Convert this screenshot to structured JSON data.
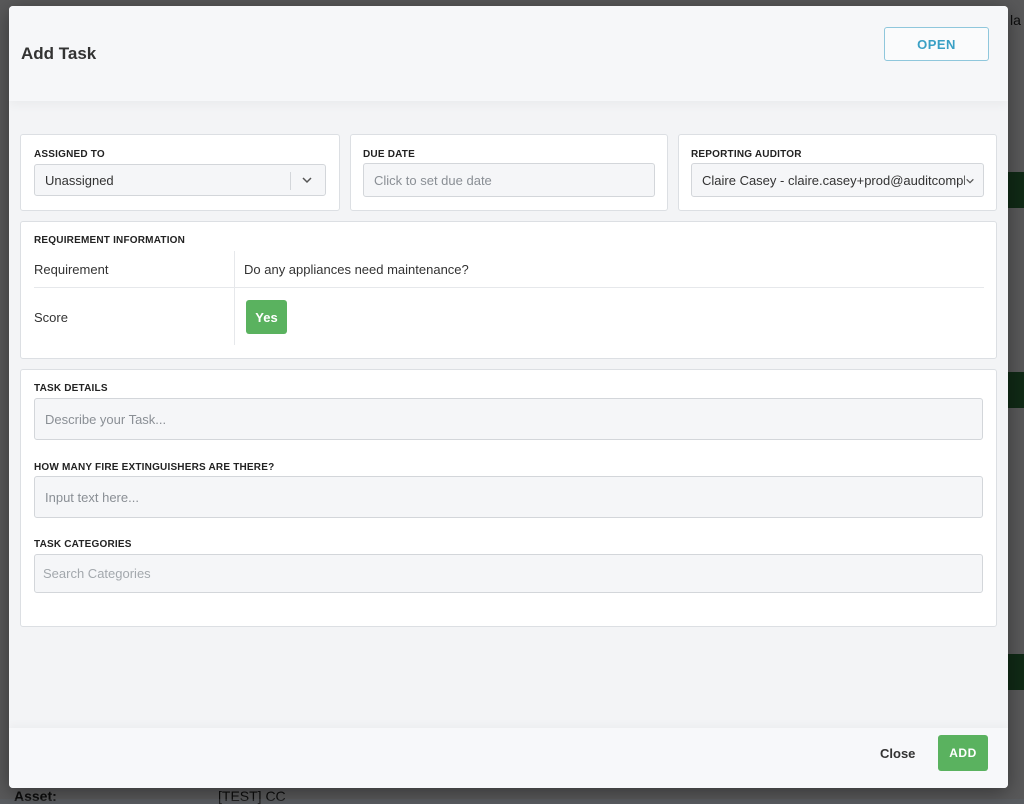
{
  "background": {
    "bottom_label": "Asset:",
    "bottom_value": "[TEST] CC",
    "corner_text": "la"
  },
  "modal": {
    "title": "Add Task",
    "status_button": "OPEN",
    "assigned_to": {
      "label": "ASSIGNED TO",
      "value": "Unassigned"
    },
    "due_date": {
      "label": "DUE DATE",
      "placeholder": "Click to set due date"
    },
    "reporting_auditor": {
      "label": "REPORTING AUDITOR",
      "value": "Claire Casey - claire.casey+prod@auditcomply.com"
    },
    "requirement_info": {
      "label": "REQUIREMENT INFORMATION",
      "rows": [
        {
          "key": "Requirement",
          "value": "Do any appliances need maintenance?"
        },
        {
          "key": "Score",
          "value": "Yes"
        }
      ]
    },
    "task_details": {
      "label": "TASK DETAILS",
      "placeholder": "Describe your Task..."
    },
    "fire_extinguishers": {
      "label": "HOW MANY FIRE EXTINGUISHERS ARE THERE?",
      "placeholder": "Input text here..."
    },
    "task_categories": {
      "label": "TASK CATEGORIES",
      "placeholder": "Search Categories"
    },
    "footer": {
      "close_label": "Close",
      "add_label": "ADD"
    }
  },
  "colors": {
    "accent_green": "#5ab25f",
    "status_blue": "#3aa0c5"
  }
}
